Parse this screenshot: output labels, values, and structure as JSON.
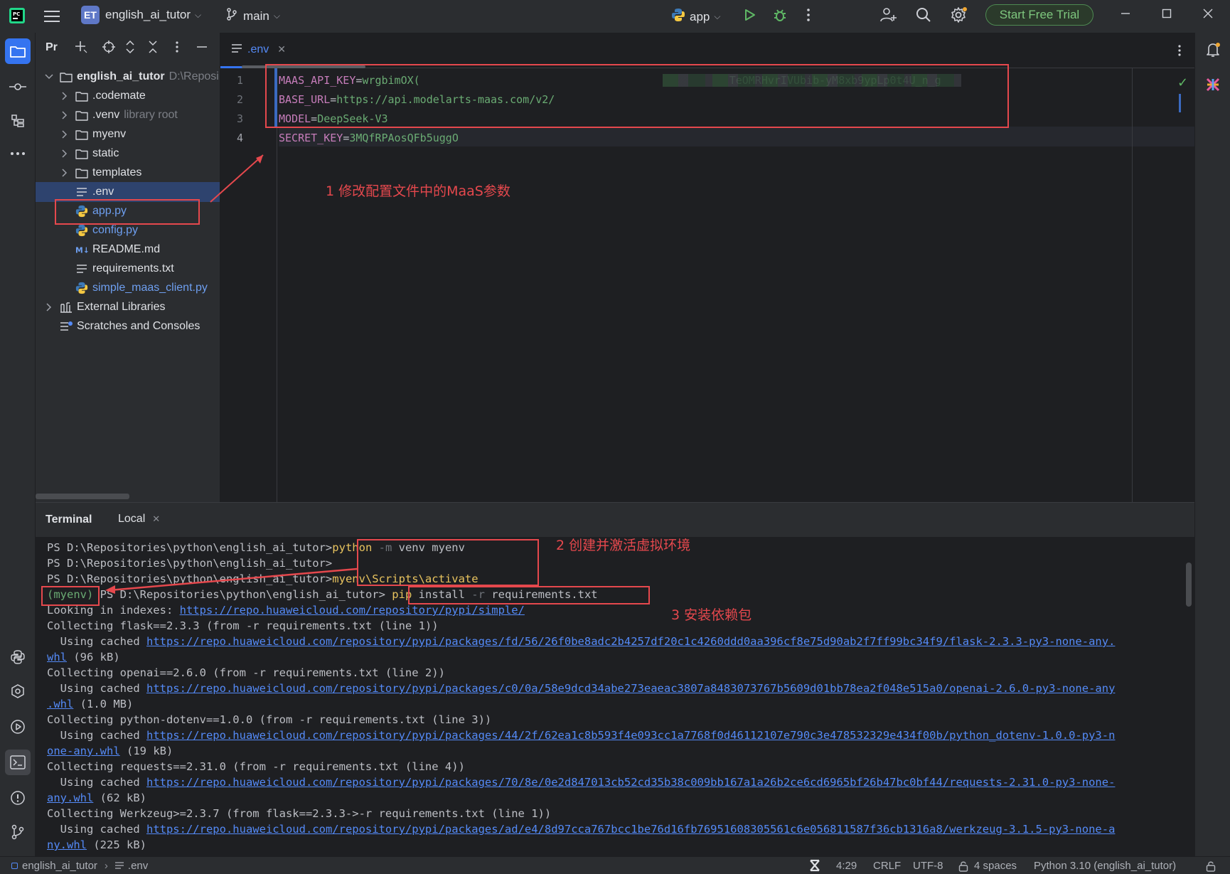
{
  "titlebar": {
    "project_badge": "ET",
    "project_name": "english_ai_tutor",
    "branch": "main",
    "run_config": "app",
    "trial_button": "Start Free Trial"
  },
  "project_panel": {
    "title": "Pr",
    "items": [
      {
        "label": "english_ai_tutor",
        "extra": "D:\\Reposi",
        "type": "folder-open"
      },
      {
        "label": ".codemate",
        "extra": "",
        "type": "folder"
      },
      {
        "label": ".venv",
        "extra": "library root",
        "type": "folder"
      },
      {
        "label": "myenv",
        "extra": "",
        "type": "folder"
      },
      {
        "label": "static",
        "extra": "",
        "type": "folder"
      },
      {
        "label": "templates",
        "extra": "",
        "type": "folder"
      },
      {
        "label": ".env",
        "extra": "",
        "type": "text-file"
      },
      {
        "label": "app.py",
        "extra": "",
        "type": "python-file"
      },
      {
        "label": "config.py",
        "extra": "",
        "type": "python-file"
      },
      {
        "label": "README.md",
        "extra": "",
        "type": "markdown-file"
      },
      {
        "label": "requirements.txt",
        "extra": "",
        "type": "text-file"
      },
      {
        "label": "simple_maas_client.py",
        "extra": "",
        "type": "python-file"
      },
      {
        "label": "External Libraries",
        "extra": "",
        "type": "library"
      },
      {
        "label": "Scratches and Consoles",
        "extra": "",
        "type": "scratch"
      }
    ]
  },
  "editor": {
    "tab": ".env",
    "lines": [
      {
        "num": "1",
        "key": "MAAS_API_KEY",
        "eq": "=",
        "value_start": "wrgbimOX(",
        "value_end": "TeOMRHvrIVUbib-yM8xb9ypLp0t4U_n_g"
      },
      {
        "num": "2",
        "key": "BASE_URL",
        "eq": "=",
        "value_start": "https://api.modelarts-maas.com/v2/",
        "value_end": ""
      },
      {
        "num": "3",
        "key": "MODEL",
        "eq": "=",
        "value_start": "DeepSeek-V3",
        "value_end": ""
      },
      {
        "num": "4",
        "key": "SECRET_KEY",
        "eq": "=",
        "value_start": "3MQfRPAosQFb5uggO",
        "value_end": ""
      }
    ]
  },
  "annotations": {
    "a1": "1 修改配置文件中的MaaS参数",
    "a2": "2 创建并激活虚拟环境",
    "a3": "3 安装依赖包"
  },
  "terminal": {
    "tab_terminal": "Terminal",
    "tab_local": "Local",
    "prompt": "PS D:\\Repositories\\python\\english_ai_tutor>",
    "venv": "(myenv)",
    "cmd1": {
      "a": "python",
      "b": "-m",
      "c": " venv myenv"
    },
    "cmd3": "myenv\\Scripts\\activate",
    "cmd4": {
      "a": "pip",
      "b": " install ",
      "c": "-r",
      "d": " requirements.txt"
    },
    "lines": {
      "l5a": "Looking in indexes: ",
      "l5link": "https://repo.huaweicloud.com/repository/pypi/simple/",
      "l6": "Collecting flask==2.3.3 (from -r requirements.txt (line 1))",
      "l7a": "  Using cached ",
      "l7link": "https://repo.huaweicloud.com/repository/pypi/packages/fd/56/26f0be8adc2b4257df20c1c4260ddd0aa396cf8e75d90ab2f7ff99bc34f9/flask-2.3.3-py3-none-any.",
      "l8link": "whl",
      "l8b": " (96 kB)",
      "l9": "Collecting openai==2.6.0 (from -r requirements.txt (line 2))",
      "l10link": "https://repo.huaweicloud.com/repository/pypi/packages/c0/0a/58e9dcd34abe273eaeac3807a8483073767b5609d01bb78ea2f048e515a0/openai-2.6.0-py3-none-any",
      "l11link": ".whl",
      "l11b": " (1.0 MB)",
      "l12": "Collecting python-dotenv==1.0.0 (from -r requirements.txt (line 3))",
      "l13link": "https://repo.huaweicloud.com/repository/pypi/packages/44/2f/62ea1c8b593f4e093cc1a7768f0d46112107e790c3e478532329e434f00b/python_dotenv-1.0.0-py3-n",
      "l14link": "one-any.whl",
      "l14b": " (19 kB)",
      "l15": "Collecting requests==2.31.0 (from -r requirements.txt (line 4))",
      "l16link": "https://repo.huaweicloud.com/repository/pypi/packages/70/8e/0e2d847013cb52cd35b38c009bb167a1a26b2ce6cd6965bf26b47bc0bf44/requests-2.31.0-py3-none-",
      "l17link": "any.whl",
      "l17b": " (62 kB)",
      "l18": "Collecting Werkzeug>=2.3.7 (from flask==2.3.3->-r requirements.txt (line 1))",
      "l19link": "https://repo.huaweicloud.com/repository/pypi/packages/ad/e4/8d97cca767bcc1be76d16fb76951608305561c6e056811587f36cb1316a8/werkzeug-3.1.5-py3-none-a",
      "l20a": "ny.whl",
      "l20b": " (225 kB)"
    }
  },
  "statusbar": {
    "project": "english_ai_tutor",
    "file": ".env",
    "position": "4:29",
    "line_sep": "CRLF",
    "encoding": "UTF-8",
    "indent": "4 spaces",
    "interpreter": "Python 3.10 (english_ai_tutor)"
  },
  "colors": {
    "accent": "#3574f0",
    "annotation": "#e5484d",
    "trial": "#7ec77e"
  }
}
